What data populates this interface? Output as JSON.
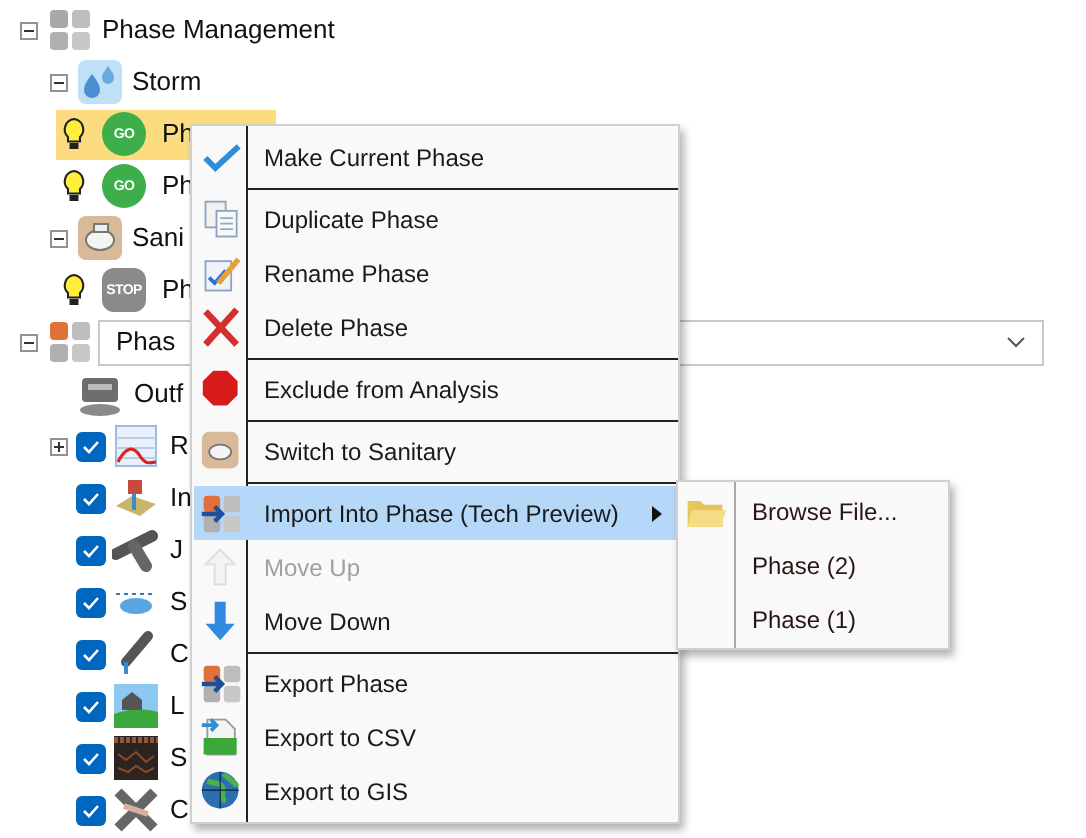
{
  "tree": [
    {
      "label": "Phase Management",
      "expanded": true,
      "children": [
        {
          "label": "Storm",
          "expanded": true,
          "children": [
            {
              "kind": "phase",
              "label": "Ph",
              "sign": {
                "kind": "go",
                "text": "GO"
              },
              "selected": true
            },
            {
              "kind": "phase",
              "label": "Ph",
              "sign": {
                "kind": "go",
                "text": "GO"
              },
              "selected": false
            }
          ]
        },
        {
          "label": "Sani",
          "expanded": true,
          "children": [
            {
              "kind": "phase",
              "label": "Ph",
              "sign": {
                "kind": "stop",
                "text": "STOP"
              },
              "selected": false
            }
          ]
        }
      ]
    },
    {
      "kind": "combo",
      "value": "Phas",
      "expanded": true,
      "children": [
        {
          "kind": "group",
          "label": "Outf"
        },
        {
          "kind": "layer",
          "label": "R",
          "checked": true,
          "expanded": false
        },
        {
          "kind": "layer",
          "label": "In",
          "checked": true
        },
        {
          "kind": "layer",
          "label": "J",
          "checked": true
        },
        {
          "kind": "layer",
          "label": "S",
          "checked": true
        },
        {
          "kind": "layer",
          "label": "C",
          "checked": true
        },
        {
          "kind": "layer",
          "label": "L",
          "checked": true
        },
        {
          "kind": "layer",
          "label": "S",
          "checked": true
        },
        {
          "kind": "layer",
          "label": "C",
          "checked": true
        }
      ]
    }
  ],
  "context_menu": {
    "groups": [
      [
        {
          "label": "Make Current Phase",
          "selected": false,
          "disabled": false
        }
      ],
      [
        {
          "label": "Duplicate Phase",
          "selected": false,
          "disabled": false
        },
        {
          "label": "Rename Phase",
          "selected": false,
          "disabled": false
        },
        {
          "label": "Delete Phase",
          "selected": false,
          "disabled": false
        }
      ],
      [
        {
          "label": "Exclude from Analysis",
          "selected": false,
          "disabled": false
        }
      ],
      [
        {
          "label": "Switch to Sanitary",
          "selected": false,
          "disabled": false
        }
      ],
      [
        {
          "label": "Import Into Phase (Tech Preview)",
          "selected": true,
          "disabled": false,
          "submenu": [
            {
              "label": "Browse File..."
            },
            {
              "label": "Phase (2)"
            },
            {
              "label": "Phase (1)"
            }
          ]
        },
        {
          "label": "Move Up",
          "selected": false,
          "disabled": true
        },
        {
          "label": "Move Down",
          "selected": false,
          "disabled": false
        }
      ],
      [
        {
          "label": "Export Phase",
          "selected": false,
          "disabled": false
        },
        {
          "label": "Export to CSV",
          "selected": false,
          "disabled": false
        },
        {
          "label": "Export to GIS",
          "selected": false,
          "disabled": false
        }
      ]
    ]
  }
}
